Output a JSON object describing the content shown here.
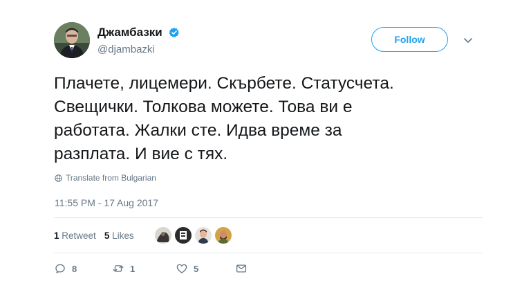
{
  "user": {
    "display_name": "Джамбазки",
    "handle": "@djambazki",
    "verified_icon": "verified-badge-icon",
    "avatar_icon": "profile-photo"
  },
  "follow_label": "Follow",
  "tweet": {
    "lines": [
      "Плачете, лицемери. Скърбете. Статусчета.",
      "Свещички. Толкова можете. Това ви е",
      "работата. Жалки сте. Идва време за",
      "разплата. И вие с тях."
    ]
  },
  "translate_label": "Translate from Bulgarian",
  "timestamp": "11:55 PM - 17 Aug 2017",
  "stats": {
    "retweets_count": "1",
    "retweets_label": "Retweet",
    "likes_count": "5",
    "likes_label": "Likes"
  },
  "actions": {
    "reply_count": "8",
    "retweet_count": "1",
    "like_count": "5"
  },
  "colors": {
    "accent": "#1da1f2",
    "muted": "#657786",
    "text": "#14171a",
    "divider": "#e1e8ed"
  }
}
